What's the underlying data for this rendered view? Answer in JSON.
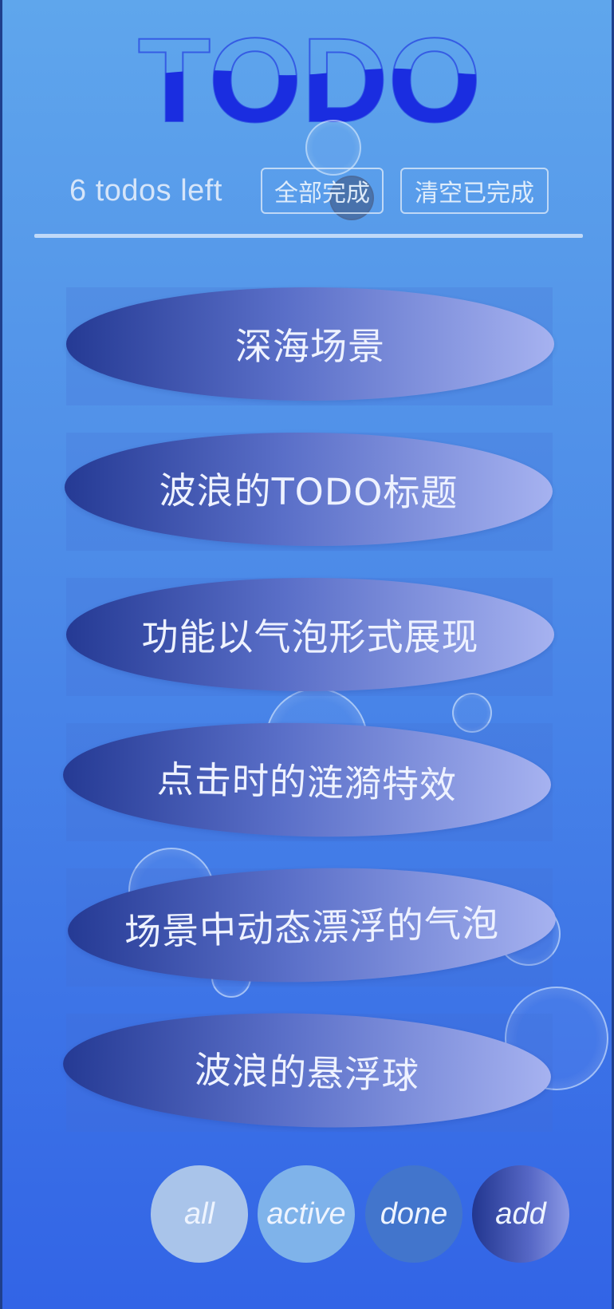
{
  "app": {
    "title": "TODO",
    "colors": {
      "background_top": "#5fa6ec",
      "background_bottom": "#3264e6",
      "title_wave": "#1a2de0",
      "pill_start": "#253a94",
      "pill_end": "#a6b2f0"
    }
  },
  "status": {
    "remaining_text": "6 todos left",
    "complete_all_label": "全部完成",
    "clear_completed_label": "清空已完成"
  },
  "todos": [
    {
      "text": "深海场景"
    },
    {
      "text": "波浪的TODO标题"
    },
    {
      "text": "功能以气泡形式展现"
    },
    {
      "text": "点击时的涟漪特效"
    },
    {
      "text": "场景中动态漂浮的气泡"
    },
    {
      "text": "波浪的悬浮球"
    }
  ],
  "filters": {
    "all": {
      "label": "all",
      "color": "#a9c4ea"
    },
    "active": {
      "label": "active",
      "color": "#7fb3ea"
    },
    "done": {
      "label": "done",
      "color": "#4275cc"
    },
    "add": {
      "label": "add",
      "color": "#2c3fa0"
    }
  }
}
